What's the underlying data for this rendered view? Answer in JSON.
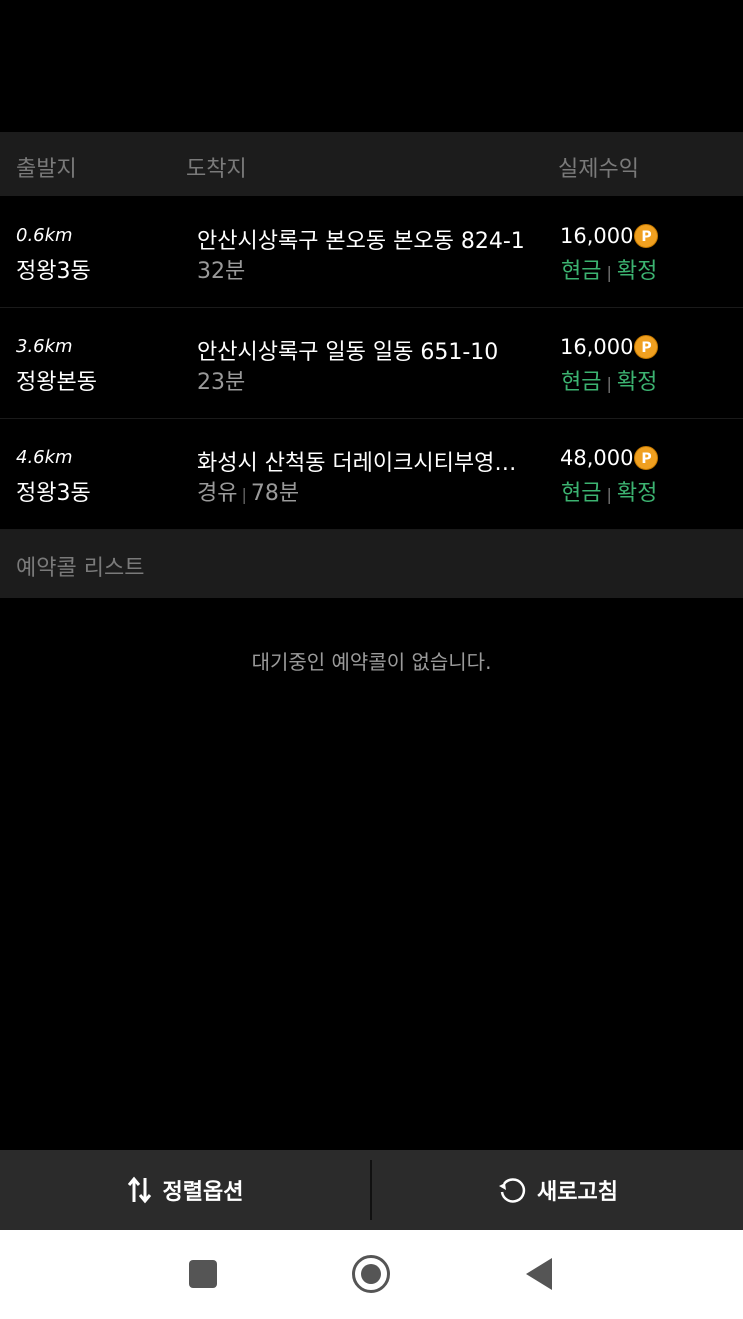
{
  "header": {
    "origin_label": "출발지",
    "dest_label": "도착지",
    "fare_label": "실제수익"
  },
  "calls": [
    {
      "distance": "0.6km",
      "origin": "정왕3동",
      "destination": "안산시상록구 본오동 본오동 824-1",
      "sub": "32분",
      "via": "",
      "fare": "16,000",
      "coin": "P",
      "payment": "현금",
      "status": "확정"
    },
    {
      "distance": "3.6km",
      "origin": "정왕본동",
      "destination": "안산시상록구 일동 일동 651-10",
      "sub": "23분",
      "via": "",
      "fare": "16,000",
      "coin": "P",
      "payment": "현금",
      "status": "확정"
    },
    {
      "distance": "4.6km",
      "origin": "정왕3동",
      "destination": "화성시 산척동 더레이크시티부영…",
      "sub": "78분",
      "via": "경유",
      "fare": "48,000",
      "coin": "P",
      "payment": "현금",
      "status": "확정"
    }
  ],
  "reservation": {
    "title": "예약콜 리스트",
    "empty_message": "대기중인 예약콜이 없습니다."
  },
  "bottom_bar": {
    "sort_label": "정렬옵션",
    "refresh_label": "새로고침"
  },
  "colors": {
    "background": "#000000",
    "header_bg": "#1c1c1c",
    "accent_green": "#3cb371",
    "coin": "#f0a020"
  },
  "icons": {
    "sort": "sort-arrows-icon",
    "refresh": "refresh-icon",
    "nav_recent": "square-icon",
    "nav_home": "home-circle-icon",
    "nav_back": "back-triangle-icon"
  }
}
